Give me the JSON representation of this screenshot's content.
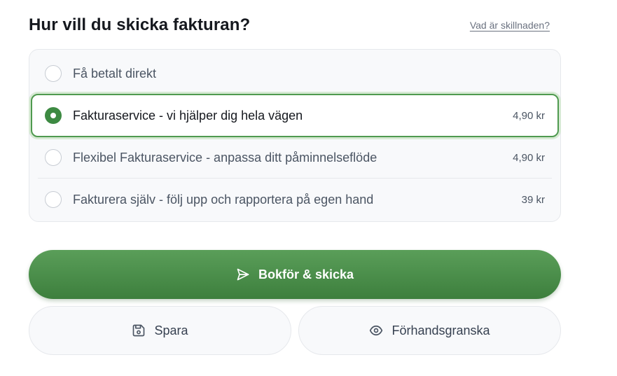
{
  "header": {
    "title": "Hur vill du skicka fakturan?",
    "help_link": "Vad är skillnaden?"
  },
  "options": [
    {
      "label": "Få betalt direkt",
      "price": "",
      "selected": false
    },
    {
      "label": "Fakturaservice - vi hjälper dig hela vägen",
      "price": "4,90 kr",
      "selected": true
    },
    {
      "label": "Flexibel Fakturaservice - anpassa ditt påminnelseflöde",
      "price": "4,90 kr",
      "selected": false
    },
    {
      "label": "Fakturera själv - följ upp och rapportera på egen hand",
      "price": "39 kr",
      "selected": false
    }
  ],
  "actions": {
    "primary_label": "Bokför & skicka",
    "primary_icon": "send-icon",
    "save_label": "Spara",
    "save_icon": "save-icon",
    "preview_label": "Förhandsgranska",
    "preview_icon": "eye-icon"
  },
  "colors": {
    "accent": "#3d8a42",
    "selected_border": "#4f9a4f",
    "primary_gradient_top": "#5a9e59",
    "primary_gradient_bottom": "#3d7f3d"
  }
}
